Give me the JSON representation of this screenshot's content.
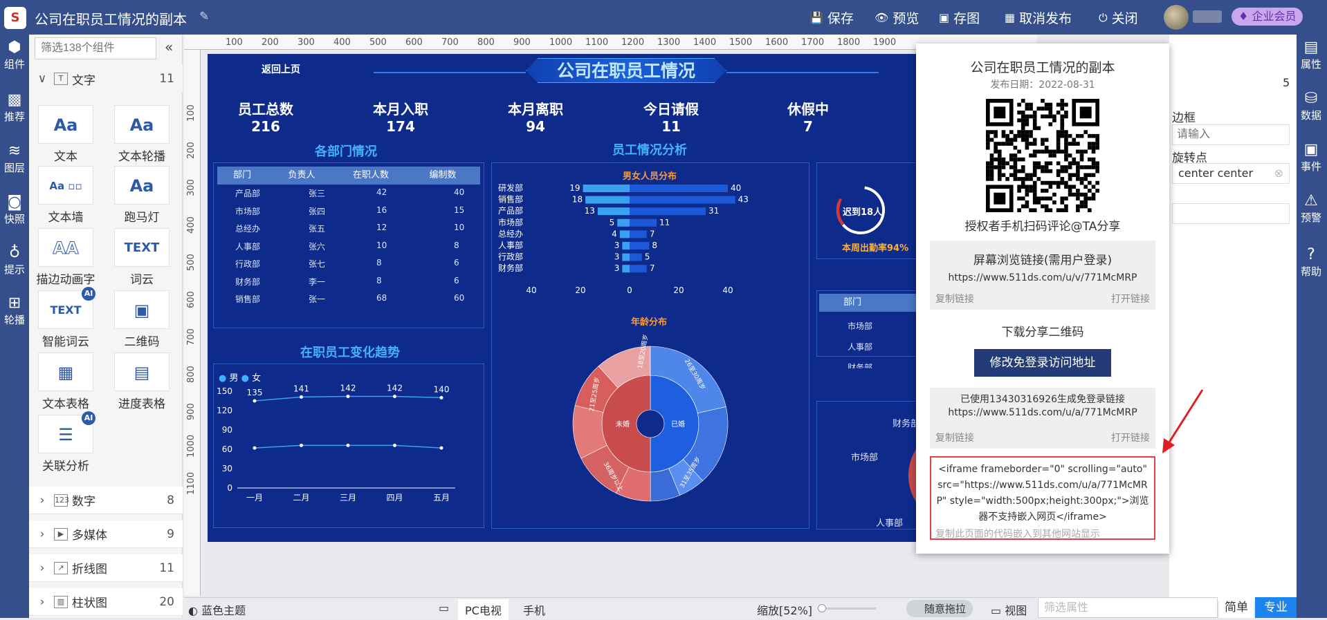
{
  "topbar": {
    "title": "公司在职员工情况的副本",
    "save": "保存",
    "preview": "预览",
    "saveimg": "存图",
    "unpublish": "取消发布",
    "close": "关闭",
    "vip": "企业会员"
  },
  "left_rail": [
    {
      "label": "组件",
      "icon": "cube-icon"
    },
    {
      "label": "推荐",
      "icon": "ai-box-icon"
    },
    {
      "label": "图层",
      "icon": "layers-icon"
    },
    {
      "label": "快照",
      "icon": "camera-icon"
    },
    {
      "label": "提示",
      "icon": "bulb-icon"
    },
    {
      "label": "轮播",
      "icon": "windows-icon"
    }
  ],
  "right_rail": [
    {
      "label": "属性",
      "icon": "props-icon"
    },
    {
      "label": "数据",
      "icon": "database-icon"
    },
    {
      "label": "事件",
      "icon": "event-icon"
    },
    {
      "label": "预警",
      "icon": "alarm-icon"
    },
    {
      "label": "帮助",
      "icon": "help-icon"
    }
  ],
  "components": {
    "search_placeholder": "筛选138个组件",
    "text_group": {
      "label": "文字",
      "count": "11"
    },
    "tiles": [
      "文本",
      "文本轮播",
      "文本墙",
      "跑马灯",
      "描边动画字",
      "词云",
      "智能词云",
      "二维码",
      "文本表格",
      "进度表格",
      "关联分析"
    ],
    "groups": [
      {
        "label": "数字",
        "count": "8"
      },
      {
        "label": "多媒体",
        "count": "9"
      },
      {
        "label": "折线图",
        "count": "11"
      },
      {
        "label": "柱状图",
        "count": "20"
      }
    ]
  },
  "dashboard": {
    "back": "返回上页",
    "title": "公司在职员工情况",
    "stats": [
      {
        "label": "员工总数",
        "value": "216"
      },
      {
        "label": "本月入职",
        "value": "174"
      },
      {
        "label": "本月离职",
        "value": "94"
      },
      {
        "label": "今日请假",
        "value": "11"
      },
      {
        "label": "休假中",
        "value": "7"
      }
    ],
    "dept_title": "各部门情况",
    "dept_headers": [
      "部门",
      "负责人",
      "在职人数",
      "编制数"
    ],
    "dept_rows": [
      [
        "产品部",
        "张三",
        "42",
        "40"
      ],
      [
        "市场部",
        "张四",
        "16",
        "15"
      ],
      [
        "总经办",
        "张五",
        "12",
        "10"
      ],
      [
        "人事部",
        "张六",
        "10",
        "8"
      ],
      [
        "行政部",
        "张七",
        "8",
        "6"
      ],
      [
        "财务部",
        "李一",
        "8",
        "6"
      ],
      [
        "销售部",
        "张一",
        "68",
        "60"
      ]
    ],
    "analysis_title": "员工情况分析",
    "gender_title": "男女人员分布",
    "age_title": "年龄分布",
    "trend_title": "在职员工变化趋势",
    "legend": [
      "男",
      "女"
    ],
    "attendance": "迟到18人",
    "attendance_rate": "本周出勤率94%",
    "right_headers": [
      "部门",
      "负"
    ],
    "right_rows": [
      "市场部",
      "人事部",
      "财务部"
    ],
    "pie_labels": [
      "财务部",
      "市场部",
      "人事部"
    ]
  },
  "chart_data": [
    {
      "type": "bar",
      "title": "男女人员分布",
      "categories": [
        "研发部",
        "销售部",
        "产品部",
        "市场部",
        "总经办",
        "人事部",
        "行政部",
        "财务部"
      ],
      "series": [
        {
          "values": [
            19,
            18,
            13,
            5,
            4,
            3,
            3,
            3
          ]
        },
        {
          "values": [
            40,
            43,
            31,
            11,
            7,
            8,
            5,
            7
          ]
        }
      ],
      "xlim": [
        -40,
        40
      ],
      "xticks": [
        "40",
        "20",
        "0",
        "20",
        "40"
      ]
    },
    {
      "type": "line",
      "title": "在职员工变化趋势",
      "categories": [
        "一月",
        "二月",
        "三月",
        "四月",
        "五月"
      ],
      "series": [
        {
          "name": "男",
          "values": [
            135,
            141,
            142,
            142,
            140
          ]
        },
        {
          "name": "女",
          "values": [
            62,
            66,
            66,
            66,
            62
          ]
        }
      ],
      "ylim": [
        0,
        150
      ],
      "yticks": [
        "150",
        "120",
        "90",
        "60",
        "30",
        "0"
      ]
    },
    {
      "type": "pie",
      "title": "年龄分布",
      "inner": [
        {
          "label": "未婚",
          "share": 0.5
        },
        {
          "label": "已婚",
          "share": 0.5
        }
      ],
      "outer": [
        {
          "label": "26至30周岁"
        },
        {
          "label": "31至35周岁"
        },
        {
          "label": "21至25周岁"
        },
        {
          "label": "36周岁以上"
        },
        {
          "label": "18至20周岁"
        }
      ]
    }
  ],
  "share": {
    "title": "公司在职员工情况的副本",
    "date": "发布日期：2022-08-31",
    "qr_caption": "授权者手机扫码评论@TA分享",
    "screen_title": "屏幕浏览链接(需用户登录)",
    "screen_url": "https://www.511ds.com/u/v/771McMRP",
    "copy": "复制链接",
    "open": "打开链接",
    "download": "下载分享二维码",
    "edit_btn": "修改免登录访问地址",
    "used_text": "已使用13430316926生成免登录链接",
    "public_url": "https://www.511ds.com/u/a/771McMRP",
    "embed": "<iframe frameborder=\"0\" scrolling=\"auto\" src=\"https://www.511ds.com/u/a/771McMRP\" style=\"width:500px;height:300px;\">浏览器不支持嵌入网页</iframe>",
    "embed_note": "复制此页面的代码嵌入到其他网站显示"
  },
  "props": {
    "count": "5",
    "border": "边框",
    "border_ph": "请输入",
    "rotate": "旋转点",
    "rotate_val": "center center",
    "filter_ph": "筛选属性"
  },
  "bottom": {
    "theme": "蓝色主题",
    "pc": "PC电视",
    "mobile": "手机",
    "zoom": "缩放[52%]",
    "drag": "随意拖拉",
    "view": "视图",
    "simple": "简单",
    "pro": "专业"
  }
}
